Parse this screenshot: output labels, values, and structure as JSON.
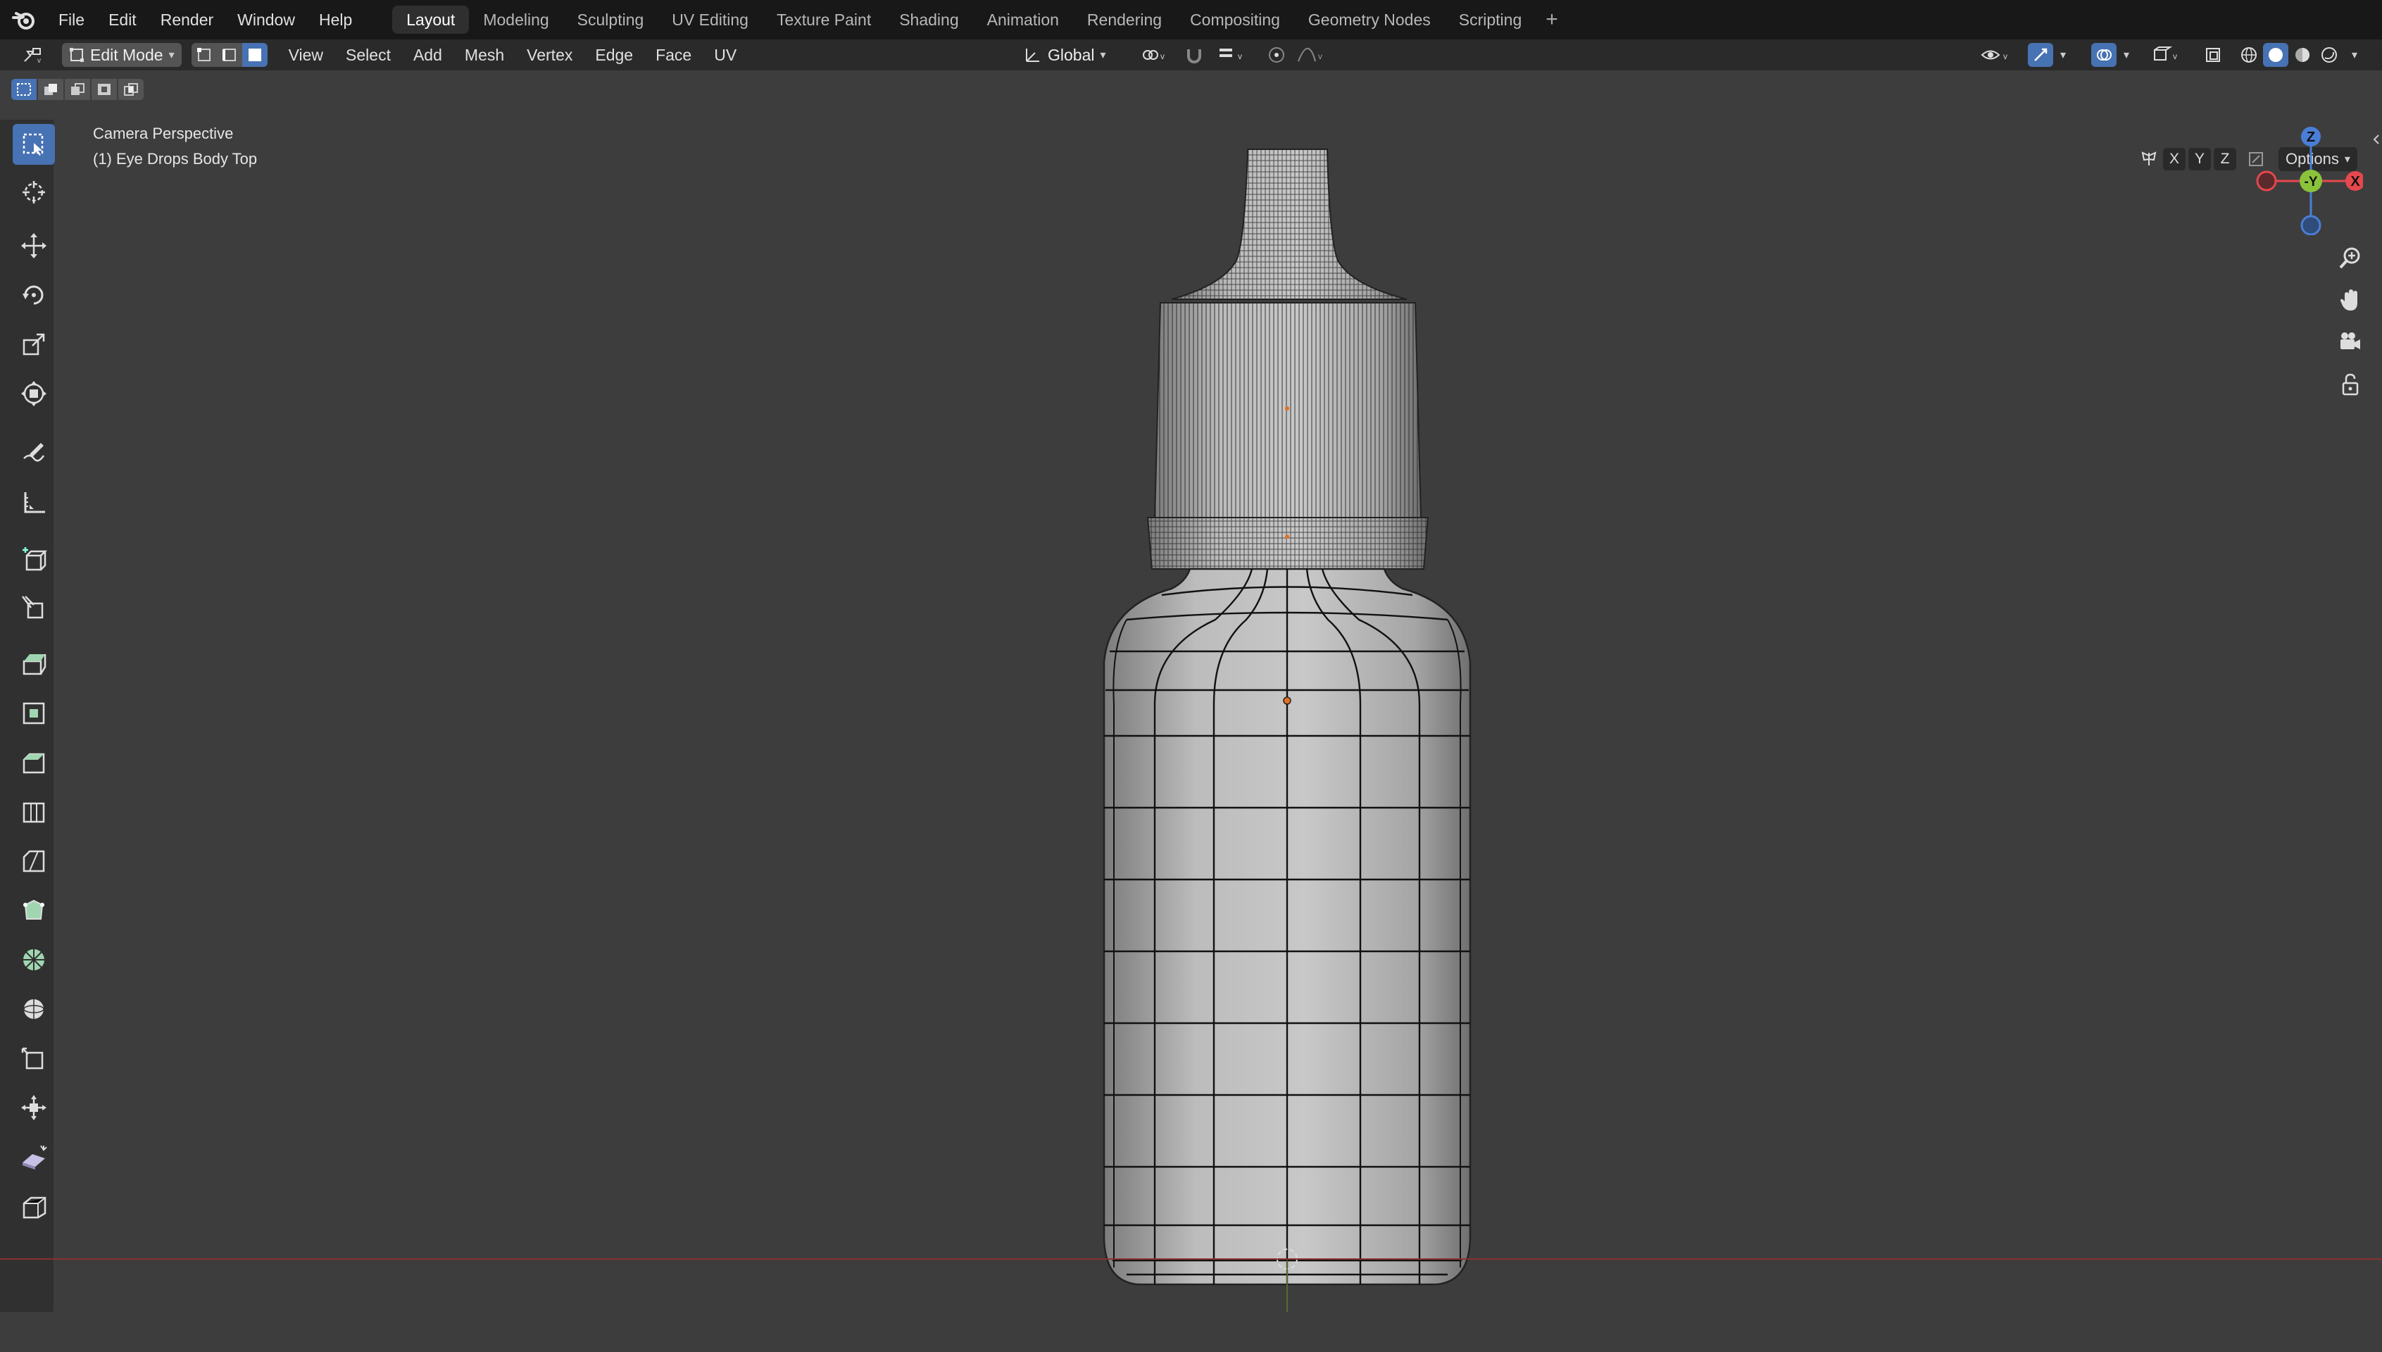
{
  "topbar": {
    "menus": [
      "File",
      "Edit",
      "Render",
      "Window",
      "Help"
    ],
    "workspaces": [
      "Layout",
      "Modeling",
      "Sculpting",
      "UV Editing",
      "Texture Paint",
      "Shading",
      "Animation",
      "Rendering",
      "Compositing",
      "Geometry Nodes",
      "Scripting"
    ],
    "active_workspace": "Layout",
    "add_label": "+"
  },
  "header": {
    "mode": "Edit Mode",
    "menus": [
      "View",
      "Select",
      "Add",
      "Mesh",
      "Vertex",
      "Edge",
      "Face",
      "UV"
    ],
    "transform_orientation": "Global"
  },
  "viewport": {
    "view_name": "Camera Perspective",
    "object_name": "(1) Eye Drops Body Top",
    "axis_keys": [
      "X",
      "Y",
      "Z"
    ],
    "options_label": "Options",
    "gizmo_labels": {
      "z": "Z",
      "y": "-Y",
      "x": "X"
    }
  },
  "colors": {
    "accent": "#4772b3",
    "axis_x": "#e5484d",
    "axis_y": "#8ac33b",
    "axis_z": "#4a7ed6"
  },
  "toolbar": {
    "tools": [
      "select-box",
      "cursor",
      "move",
      "rotate",
      "scale",
      "transform",
      "annotate",
      "measure",
      "add-cube",
      "spin-knife",
      "extrude",
      "inset",
      "bevel",
      "loop-cut",
      "knife",
      "poly-build",
      "spin",
      "smooth",
      "shrink-fatten",
      "push-pull",
      "shear",
      "to-sphere"
    ],
    "active_tool": "select-box"
  }
}
